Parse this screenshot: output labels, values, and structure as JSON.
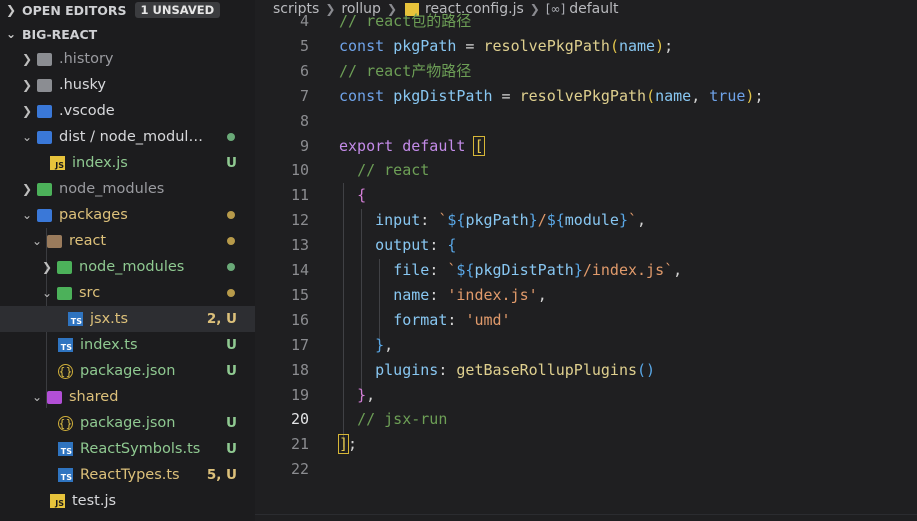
{
  "explorer": {
    "open_editors": {
      "title": "OPEN EDITORS",
      "badge": "1 UNSAVED"
    },
    "root": {
      "title": "BIG-REACT"
    },
    "items": [
      {
        "label": ".history"
      },
      {
        "label": ".husky"
      },
      {
        "label": ".vscode"
      },
      {
        "label": "dist / node_modules..."
      },
      {
        "label": "index.js",
        "status": "U"
      },
      {
        "label": "node_modules"
      },
      {
        "label": "packages"
      },
      {
        "label": "react"
      },
      {
        "label": "node_modules"
      },
      {
        "label": "src"
      },
      {
        "label": "jsx.ts",
        "status": "2, U"
      },
      {
        "label": "index.ts",
        "status": "U"
      },
      {
        "label": "package.json",
        "status": "U"
      },
      {
        "label": "shared"
      },
      {
        "label": "package.json",
        "status": "U"
      },
      {
        "label": "ReactSymbols.ts",
        "status": "U"
      },
      {
        "label": "ReactTypes.ts",
        "status": "5, U"
      },
      {
        "label": "test.js"
      }
    ]
  },
  "breadcrumb": {
    "parts": [
      "scripts",
      "rollup",
      "react.config.js",
      "default"
    ]
  },
  "editor": {
    "lines": [
      {
        "n": "4",
        "tokens": [
          [
            "cm",
            "// react包的路径"
          ]
        ]
      },
      {
        "n": "5",
        "tokens": [
          [
            "kwb",
            "const "
          ],
          [
            "var",
            "pkgPath"
          ],
          [
            "punc",
            " = "
          ],
          [
            "fn",
            "resolvePkgPath"
          ],
          [
            "br1",
            "("
          ],
          [
            "var",
            "name"
          ],
          [
            "br1",
            ")"
          ],
          [
            "punc",
            ";"
          ]
        ]
      },
      {
        "n": "6",
        "tokens": [
          [
            "cm",
            "// react产物路径"
          ]
        ]
      },
      {
        "n": "7",
        "tokens": [
          [
            "kwb",
            "const "
          ],
          [
            "var",
            "pkgDistPath"
          ],
          [
            "punc",
            " = "
          ],
          [
            "fn",
            "resolvePkgPath"
          ],
          [
            "br1",
            "("
          ],
          [
            "var",
            "name"
          ],
          [
            "punc",
            ", "
          ],
          [
            "kwb",
            "true"
          ],
          [
            "br1",
            ")"
          ],
          [
            "punc",
            ";"
          ]
        ]
      },
      {
        "n": "8",
        "tokens": []
      },
      {
        "n": "9",
        "tokens": [
          [
            "kw",
            "export default "
          ],
          [
            "br1box",
            "["
          ]
        ]
      },
      {
        "n": "10",
        "tokens": [
          [
            "sq",
            "  "
          ],
          [
            "cm",
            "// react"
          ]
        ]
      },
      {
        "n": "11",
        "tokens": [
          [
            "punc",
            "  "
          ],
          [
            "br2",
            "{"
          ]
        ]
      },
      {
        "n": "12",
        "tokens": [
          [
            "punc",
            "    "
          ],
          [
            "var",
            "input"
          ],
          [
            "punc",
            ": "
          ],
          [
            "str",
            "`"
          ],
          [
            "tpl",
            "${"
          ],
          [
            "var",
            "pkgPath"
          ],
          [
            "tpl",
            "}"
          ],
          [
            "str",
            "/"
          ],
          [
            "tpl",
            "${"
          ],
          [
            "var",
            "module"
          ],
          [
            "tpl",
            "}"
          ],
          [
            "str",
            "`"
          ],
          [
            "punc",
            ","
          ]
        ]
      },
      {
        "n": "13",
        "tokens": [
          [
            "punc",
            "    "
          ],
          [
            "var",
            "output"
          ],
          [
            "punc",
            ": "
          ],
          [
            "br3",
            "{"
          ]
        ]
      },
      {
        "n": "14",
        "tokens": [
          [
            "punc",
            "      "
          ],
          [
            "var",
            "file"
          ],
          [
            "punc",
            ": "
          ],
          [
            "str",
            "`"
          ],
          [
            "tpl",
            "${"
          ],
          [
            "var",
            "pkgDistPath"
          ],
          [
            "tpl",
            "}"
          ],
          [
            "str",
            "/index.js`"
          ],
          [
            "punc",
            ","
          ]
        ]
      },
      {
        "n": "15",
        "tokens": [
          [
            "punc",
            "      "
          ],
          [
            "var",
            "name"
          ],
          [
            "punc",
            ": "
          ],
          [
            "str",
            "'index.js'"
          ],
          [
            "punc",
            ","
          ]
        ]
      },
      {
        "n": "16",
        "tokens": [
          [
            "punc",
            "      "
          ],
          [
            "var",
            "format"
          ],
          [
            "punc",
            ": "
          ],
          [
            "str",
            "'umd'"
          ]
        ]
      },
      {
        "n": "17",
        "tokens": [
          [
            "punc",
            "    "
          ],
          [
            "br3",
            "}"
          ],
          [
            "punc",
            ","
          ]
        ]
      },
      {
        "n": "18",
        "tokens": [
          [
            "punc",
            "    "
          ],
          [
            "var",
            "plugins"
          ],
          [
            "punc",
            ": "
          ],
          [
            "fn",
            "getBaseRollupPlugins"
          ],
          [
            "br3",
            "()"
          ]
        ]
      },
      {
        "n": "19",
        "tokens": [
          [
            "punc",
            "  "
          ],
          [
            "br2",
            "}"
          ],
          [
            "sqp",
            ","
          ]
        ]
      },
      {
        "n": "20",
        "tokens": [
          [
            "sq",
            "  "
          ],
          [
            "cm",
            "// jsx-run"
          ]
        ]
      },
      {
        "n": "21",
        "tokens": [
          [
            "br1box",
            "]"
          ],
          [
            "punc",
            ";"
          ]
        ]
      },
      {
        "n": "22",
        "tokens": []
      }
    ],
    "active_line": "20"
  }
}
